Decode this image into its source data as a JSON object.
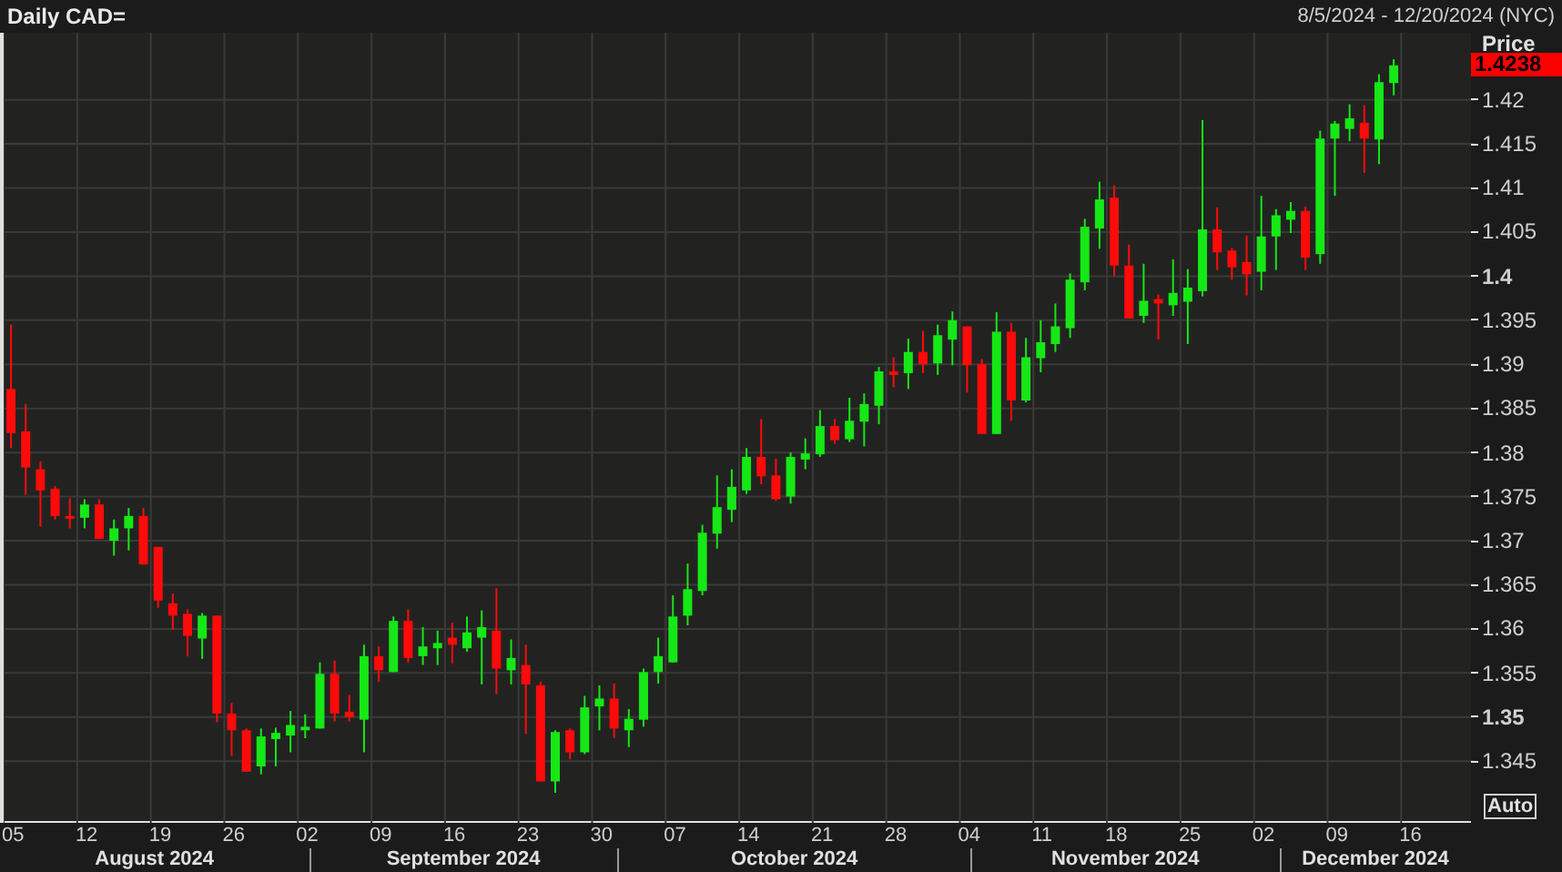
{
  "header": {
    "title": "Daily CAD=",
    "date_range": "8/5/2024 - 12/20/2024 (NYC)"
  },
  "price_axis": {
    "title": "Price",
    "last_price": "1.4238",
    "auto_button": "Auto"
  },
  "months": [
    {
      "label": "August 2024"
    },
    {
      "label": "September 2024"
    },
    {
      "label": "October 2024"
    },
    {
      "label": "November 2024"
    },
    {
      "label": "December 2024"
    }
  ],
  "chart_data": {
    "type": "candlestick",
    "grid": true,
    "ylim": [
      1.338,
      1.4276
    ],
    "categories": [
      "05",
      null,
      null,
      null,
      null,
      "12",
      null,
      null,
      null,
      null,
      "19",
      null,
      null,
      null,
      null,
      "26",
      null,
      null,
      null,
      null,
      "02",
      null,
      null,
      null,
      null,
      "09",
      null,
      null,
      null,
      null,
      "16",
      null,
      null,
      null,
      null,
      "23",
      null,
      null,
      null,
      null,
      "30",
      null,
      null,
      null,
      null,
      "07",
      null,
      null,
      null,
      null,
      "14",
      null,
      null,
      null,
      null,
      "21",
      null,
      null,
      null,
      null,
      "28",
      null,
      null,
      null,
      null,
      "04",
      null,
      null,
      null,
      null,
      "11",
      null,
      null,
      null,
      null,
      "18",
      null,
      null,
      null,
      null,
      "25",
      null,
      null,
      null,
      null,
      "02",
      null,
      null,
      null,
      null,
      "09",
      null,
      null,
      null,
      null,
      "16"
    ],
    "yticks": [
      {
        "value": 1.42,
        "label": "1.42"
      },
      {
        "value": 1.415,
        "label": "1.415"
      },
      {
        "value": 1.41,
        "label": "1.41"
      },
      {
        "value": 1.405,
        "label": "1.405"
      },
      {
        "value": 1.4,
        "label": "1.4"
      },
      {
        "value": 1.395,
        "label": "1.395"
      },
      {
        "value": 1.39,
        "label": "1.39"
      },
      {
        "value": 1.385,
        "label": "1.385"
      },
      {
        "value": 1.38,
        "label": "1.38"
      },
      {
        "value": 1.375,
        "label": "1.375"
      },
      {
        "value": 1.37,
        "label": "1.37"
      },
      {
        "value": 1.365,
        "label": "1.365"
      },
      {
        "value": 1.36,
        "label": "1.36"
      },
      {
        "value": 1.355,
        "label": "1.355"
      },
      {
        "value": 1.35,
        "label": "1.35"
      },
      {
        "value": 1.345,
        "label": "1.345"
      }
    ],
    "ohlc": [
      [
        1.3872,
        1.3945,
        1.3805,
        1.3822
      ],
      [
        1.3824,
        1.3855,
        1.3752,
        1.3783
      ],
      [
        1.3781,
        1.379,
        1.3716,
        1.3757
      ],
      [
        1.3759,
        1.3762,
        1.3724,
        1.3728
      ],
      [
        1.3728,
        1.3748,
        1.3714,
        1.3726
      ],
      [
        1.3726,
        1.3747,
        1.3714,
        1.3741
      ],
      [
        1.3741,
        1.3747,
        1.3702,
        1.3702
      ],
      [
        1.37,
        1.3724,
        1.3683,
        1.3714
      ],
      [
        1.3714,
        1.3737,
        1.3689,
        1.3728
      ],
      [
        1.3728,
        1.3737,
        1.3673,
        1.3673
      ],
      [
        1.3693,
        1.3693,
        1.3624,
        1.3632
      ],
      [
        1.3629,
        1.364,
        1.3599,
        1.3615
      ],
      [
        1.3617,
        1.3622,
        1.3569,
        1.3592
      ],
      [
        1.3589,
        1.3618,
        1.3566,
        1.3615
      ],
      [
        1.3615,
        1.3615,
        1.3494,
        1.3504
      ],
      [
        1.3504,
        1.3516,
        1.3456,
        1.3485
      ],
      [
        1.3485,
        1.3487,
        1.3438,
        1.3438
      ],
      [
        1.3444,
        1.3487,
        1.3435,
        1.3478
      ],
      [
        1.3475,
        1.3488,
        1.3444,
        1.3482
      ],
      [
        1.3479,
        1.3507,
        1.346,
        1.3491
      ],
      [
        1.3485,
        1.3503,
        1.3476,
        1.3489
      ],
      [
        1.3487,
        1.3562,
        1.3487,
        1.3549
      ],
      [
        1.3549,
        1.3564,
        1.3495,
        1.3504
      ],
      [
        1.3506,
        1.3525,
        1.3495,
        1.35
      ],
      [
        1.3497,
        1.3582,
        1.346,
        1.3569
      ],
      [
        1.3569,
        1.358,
        1.354,
        1.3553
      ],
      [
        1.3551,
        1.3614,
        1.3551,
        1.3609
      ],
      [
        1.3609,
        1.3622,
        1.3562,
        1.3567
      ],
      [
        1.3569,
        1.3602,
        1.3559,
        1.358
      ],
      [
        1.3578,
        1.3598,
        1.3559,
        1.3584
      ],
      [
        1.359,
        1.3607,
        1.3561,
        1.3582
      ],
      [
        1.3578,
        1.3614,
        1.3574,
        1.3596
      ],
      [
        1.359,
        1.3621,
        1.3537,
        1.3602
      ],
      [
        1.3598,
        1.3646,
        1.3526,
        1.3555
      ],
      [
        1.3553,
        1.3588,
        1.3537,
        1.3567
      ],
      [
        1.3559,
        1.3582,
        1.3481,
        1.3537
      ],
      [
        1.3536,
        1.354,
        1.3427,
        1.3427
      ],
      [
        1.3427,
        1.3485,
        1.3414,
        1.3483
      ],
      [
        1.3485,
        1.3487,
        1.3452,
        1.346
      ],
      [
        1.346,
        1.3524,
        1.3458,
        1.3511
      ],
      [
        1.3512,
        1.3536,
        1.3485,
        1.3521
      ],
      [
        1.3521,
        1.3538,
        1.3476,
        1.3487
      ],
      [
        1.3485,
        1.3509,
        1.3466,
        1.3498
      ],
      [
        1.3497,
        1.3555,
        1.3489,
        1.3551
      ],
      [
        1.3551,
        1.359,
        1.3538,
        1.3569
      ],
      [
        1.3562,
        1.3638,
        1.3562,
        1.3614
      ],
      [
        1.3615,
        1.3674,
        1.3604,
        1.3645
      ],
      [
        1.3643,
        1.3718,
        1.3638,
        1.3709
      ],
      [
        1.3708,
        1.3774,
        1.3691,
        1.3738
      ],
      [
        1.3735,
        1.3781,
        1.3721,
        1.3761
      ],
      [
        1.3757,
        1.3805,
        1.3753,
        1.3795
      ],
      [
        1.3795,
        1.3838,
        1.3764,
        1.3773
      ],
      [
        1.3774,
        1.3793,
        1.3745,
        1.3747
      ],
      [
        1.375,
        1.38,
        1.3742,
        1.3795
      ],
      [
        1.3792,
        1.3816,
        1.3781,
        1.3799
      ],
      [
        1.3798,
        1.3848,
        1.3795,
        1.383
      ],
      [
        1.383,
        1.3838,
        1.381,
        1.3814
      ],
      [
        1.3815,
        1.3862,
        1.3812,
        1.3836
      ],
      [
        1.3835,
        1.3867,
        1.3807,
        1.3855
      ],
      [
        1.3853,
        1.3897,
        1.3832,
        1.3892
      ],
      [
        1.3892,
        1.3908,
        1.3874,
        1.3888
      ],
      [
        1.389,
        1.3929,
        1.3872,
        1.3914
      ],
      [
        1.3914,
        1.3938,
        1.389,
        1.39
      ],
      [
        1.3901,
        1.3945,
        1.3888,
        1.3933
      ],
      [
        1.3928,
        1.396,
        1.3899,
        1.395
      ],
      [
        1.3943,
        1.3943,
        1.3868,
        1.3899
      ],
      [
        1.39,
        1.3906,
        1.3821,
        1.3821
      ],
      [
        1.3821,
        1.3959,
        1.3821,
        1.3937
      ],
      [
        1.3937,
        1.3947,
        1.3836,
        1.3859
      ],
      [
        1.3859,
        1.393,
        1.3857,
        1.3908
      ],
      [
        1.3907,
        1.395,
        1.3891,
        1.3925
      ],
      [
        1.3923,
        1.3969,
        1.3914,
        1.3943
      ],
      [
        1.3941,
        1.4003,
        1.393,
        1.3996
      ],
      [
        1.3993,
        1.4065,
        1.3984,
        1.4056
      ],
      [
        1.4054,
        1.4107,
        1.4031,
        1.4087
      ],
      [
        1.4089,
        1.4103,
        1.4,
        1.4012
      ],
      [
        1.4012,
        1.4036,
        1.3952,
        1.3952
      ],
      [
        1.3955,
        1.4014,
        1.3947,
        1.3972
      ],
      [
        1.3974,
        1.3979,
        1.3928,
        1.3969
      ],
      [
        1.3967,
        1.4019,
        1.3955,
        1.3981
      ],
      [
        1.3971,
        1.4008,
        1.3923,
        1.3987
      ],
      [
        1.3983,
        1.4177,
        1.3977,
        1.4053
      ],
      [
        1.4053,
        1.4078,
        1.4007,
        1.4027
      ],
      [
        1.4029,
        1.4032,
        1.3996,
        1.401
      ],
      [
        1.4016,
        1.4046,
        1.3978,
        1.4002
      ],
      [
        1.4005,
        1.4091,
        1.3984,
        1.4045
      ],
      [
        1.4045,
        1.4076,
        1.4007,
        1.4069
      ],
      [
        1.4064,
        1.4084,
        1.4049,
        1.4074
      ],
      [
        1.4074,
        1.4079,
        1.4007,
        1.4021
      ],
      [
        1.4025,
        1.4165,
        1.4014,
        1.4156
      ],
      [
        1.4156,
        1.4176,
        1.4091,
        1.4173
      ],
      [
        1.4167,
        1.4195,
        1.4153,
        1.4179
      ],
      [
        1.4174,
        1.4194,
        1.4117,
        1.4156
      ],
      [
        1.4155,
        1.4229,
        1.4127,
        1.422
      ],
      [
        1.4219,
        1.4246,
        1.4205,
        1.4239
      ],
      null
    ]
  }
}
